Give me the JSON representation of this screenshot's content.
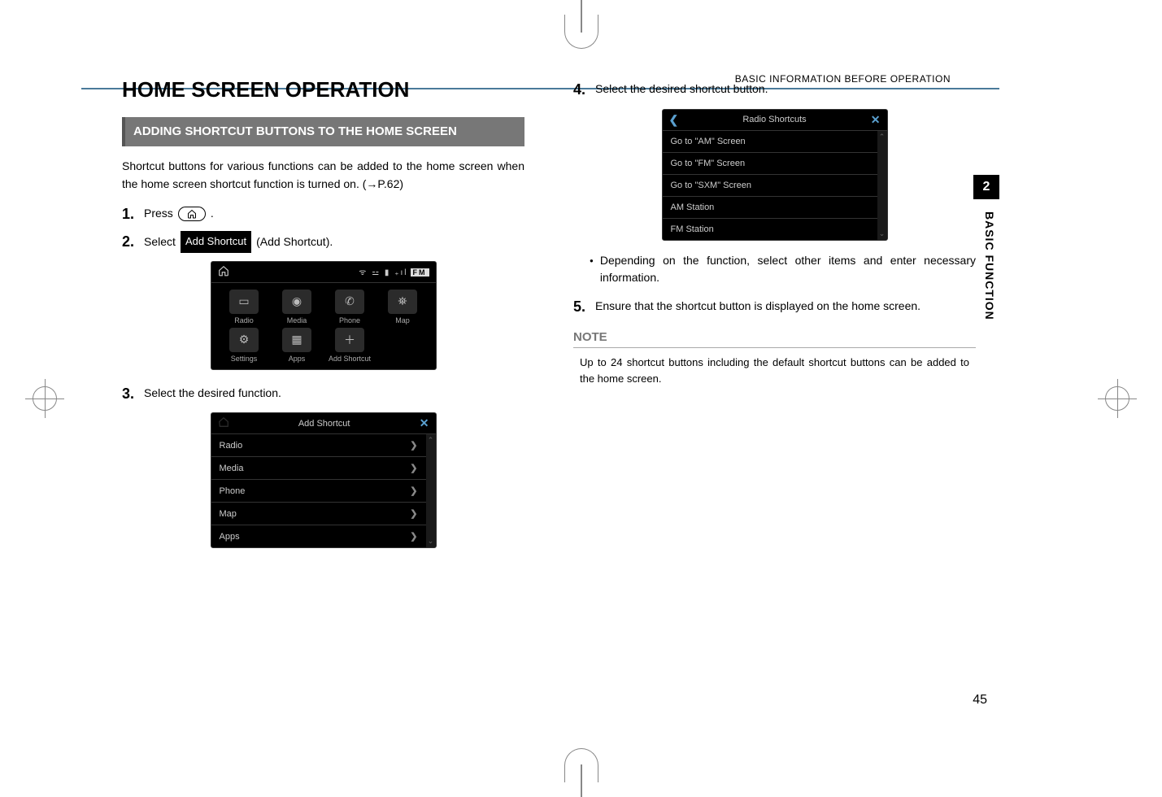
{
  "header": {
    "section": "BASIC INFORMATION BEFORE OPERATION"
  },
  "tab": {
    "number": "2",
    "label": "BASIC FUNCTION"
  },
  "title": "HOME SCREEN OPERATION",
  "subhead": "ADDING SHORTCUT BUTTONS TO THE HOME SCREEN",
  "intro": "Shortcut buttons for various functions can be added to the home screen when the home screen shortcut function is turned on. (→P.62)",
  "steps": {
    "s1_num": "1.",
    "s1_text": "Press",
    "s2_num": "2.",
    "s2_pre": "Select",
    "s2_btn": "Add Shortcut",
    "s2_post": " (Add Shortcut).",
    "s3_num": "3.",
    "s3_text": "Select the desired function.",
    "s4_num": "4.",
    "s4_text": "Select the desired shortcut button.",
    "s4_bullet": "Depending on the function, select other items and enter necessary information.",
    "s5_num": "5.",
    "s5_text": "Ensure that the shortcut button is displayed on the home screen."
  },
  "note": {
    "head": "NOTE",
    "body": "Up to 24 shortcut buttons including the default shortcut buttons can be added to the home screen."
  },
  "ss_home": {
    "fm": "FM",
    "items": [
      "Radio",
      "Media",
      "Phone",
      "Map",
      "Settings",
      "Apps",
      "Add Shortcut"
    ]
  },
  "ss_add": {
    "title": "Add Shortcut",
    "rows": [
      "Radio",
      "Media",
      "Phone",
      "Map",
      "Apps"
    ]
  },
  "ss_radio": {
    "title": "Radio Shortcuts",
    "rows": [
      "Go to \"AM\" Screen",
      "Go to \"FM\" Screen",
      "Go to \"SXM\" Screen",
      "AM Station",
      "FM Station"
    ]
  },
  "page_number": "45"
}
